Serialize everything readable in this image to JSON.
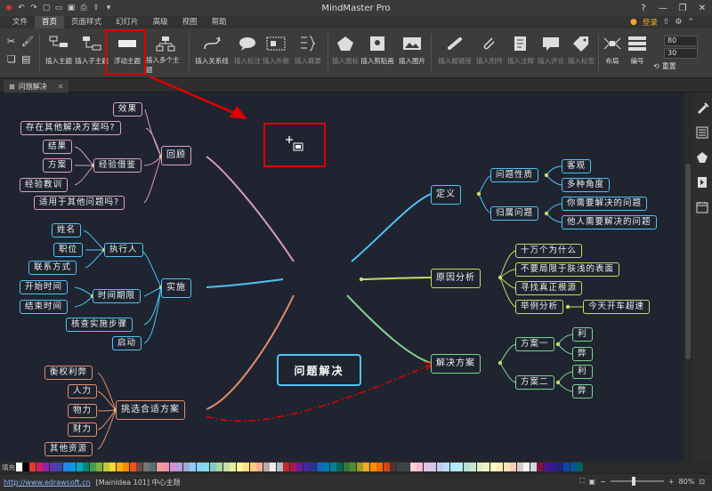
{
  "app": {
    "title": "MindMaster Pro"
  },
  "menu": {
    "items": [
      "文件",
      "首页",
      "页面样式",
      "幻灯片",
      "高级",
      "视图",
      "帮助"
    ],
    "active": "首页",
    "login_label": "登录"
  },
  "ribbon": {
    "buttons": [
      {
        "label": "插入主题"
      },
      {
        "label": "插入子主题"
      },
      {
        "label": "浮动主题"
      },
      {
        "label": "插入多个主题"
      },
      {
        "label": "插入关系线"
      },
      {
        "label": "插入标注"
      },
      {
        "label": "插入外框"
      },
      {
        "label": "插入概要"
      },
      {
        "label": "插入图标"
      },
      {
        "label": "插入剪贴画"
      },
      {
        "label": "插入图片"
      },
      {
        "label": "插入超链接"
      },
      {
        "label": "插入附件"
      },
      {
        "label": "插入注释"
      },
      {
        "label": "插入评论"
      },
      {
        "label": "插入标签"
      },
      {
        "label": "布局"
      },
      {
        "label": "编号"
      }
    ],
    "spin1": "80",
    "spin2": "30",
    "reset_label": "重置"
  },
  "document": {
    "tab_label": "问题解决"
  },
  "mindmap": {
    "center": "问题解决",
    "review": {
      "label": "回顾",
      "children": [
        "效果",
        "存在其他解决方案吗?",
        "经验借鉴",
        "适用于其他问题吗?"
      ],
      "exp_children": [
        "结果",
        "方案",
        "经验教训"
      ]
    },
    "implement": {
      "label": "实施",
      "children": [
        "执行人",
        "时间期限",
        "核查实施步骤",
        "启动"
      ],
      "exec_children": [
        "姓名",
        "职位",
        "联系方式"
      ],
      "time_children": [
        "开始时间",
        "结束时间"
      ]
    },
    "choose": {
      "label": "挑选合适方案",
      "children": [
        "衡权利弊",
        "人力",
        "物力",
        "财力",
        "其他资源"
      ]
    },
    "define": {
      "label": "定义",
      "children": [
        "问题性质",
        "归属问题"
      ],
      "nature_children": [
        "客观",
        "多种角度"
      ],
      "owner_children": [
        "你需要解决的问题",
        "他人需要解决的问题"
      ]
    },
    "cause": {
      "label": "原因分析",
      "children": [
        "十万个为什么",
        "不要局限于肤浅的表面",
        "寻找真正根源",
        "举例分析"
      ],
      "example_child": "今天开车超速"
    },
    "solution": {
      "label": "解决方案",
      "children": [
        "方案一",
        "方案二"
      ],
      "pro": "利",
      "con": "弊"
    }
  },
  "palette": {
    "label": "填充",
    "colors": [
      "#ffffff",
      "#000000",
      "#e53935",
      "#d81b60",
      "#8e24aa",
      "#5e35b1",
      "#3949ab",
      "#1e88e5",
      "#039be5",
      "#00acc1",
      "#00897b",
      "#43a047",
      "#7cb342",
      "#c0ca33",
      "#fdd835",
      "#ffb300",
      "#fb8c00",
      "#f4511e",
      "#6d4c41",
      "#757575",
      "#546e7a",
      "#ef9a9a",
      "#f48fb1",
      "#ce93d8",
      "#b39ddb",
      "#9fa8da",
      "#90caf9",
      "#81d4fa",
      "#80deea",
      "#80cbc4",
      "#a5d6a7",
      "#c5e1a5",
      "#e6ee9c",
      "#fff59d",
      "#ffe082",
      "#ffcc80",
      "#ffab91",
      "#bcaaa4",
      "#eeeeee",
      "#b0bec5",
      "#c62828",
      "#ad1457",
      "#6a1b9a",
      "#4527a0",
      "#283593",
      "#1565c0",
      "#0277bd",
      "#00838f",
      "#00695c",
      "#2e7d32",
      "#558b2f",
      "#9e9d24",
      "#f9a825",
      "#ff8f00",
      "#ef6c00",
      "#d84315",
      "#4e342e",
      "#424242",
      "#37474f",
      "#ffcdd2",
      "#f8bbd0",
      "#e1bee7",
      "#d1c4e9",
      "#c5cae9",
      "#bbdefb",
      "#b3e5fc",
      "#b2ebf2",
      "#b2dfdb",
      "#c8e6c9",
      "#dcedc8",
      "#f0f4c3",
      "#fff9c4",
      "#ffecb3",
      "#ffe0b2",
      "#ffccbc",
      "#d7ccc8",
      "#f5f5f5",
      "#cfd8dc",
      "#880e4f",
      "#4a148c",
      "#311b92",
      "#1a237e",
      "#0d47a1",
      "#01579b",
      "#006064",
      "#004d40",
      "#1b5e20",
      "#33691e",
      "#827717",
      "#f57f17",
      "#ff6f00",
      "#e65100",
      "#bf360c",
      "#3e2723",
      "#212121",
      "#263238"
    ]
  },
  "status": {
    "url": "http://www.edrawsoft.cn",
    "info": "[MainIdea 101]  中心主题",
    "zoom": "80%"
  }
}
